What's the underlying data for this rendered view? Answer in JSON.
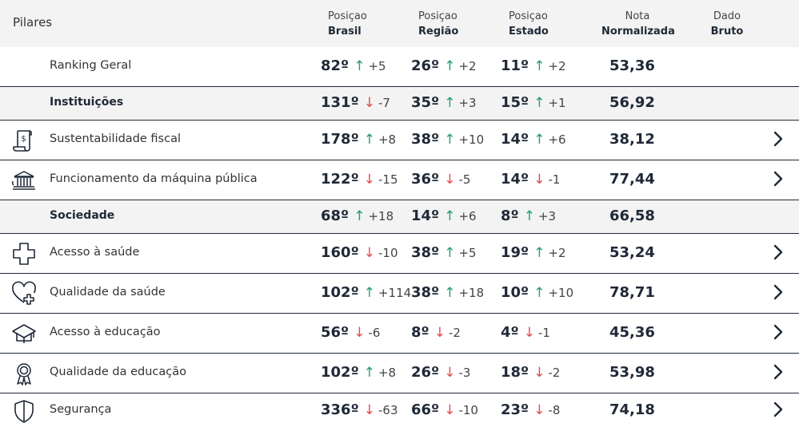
{
  "header": {
    "pilares": "Pilares",
    "col_brasil_top": "Posiçao",
    "col_brasil_sub": "Brasil",
    "col_regiao_top": "Posiçao",
    "col_regiao_sub": "Região",
    "col_estado_top": "Posiçao",
    "col_estado_sub": "Estado",
    "col_nota_top": "Nota",
    "col_nota_sub": "Normalizada",
    "col_dado_top": "Dado",
    "col_dado_sub": "Bruto"
  },
  "colors": {
    "up": "#22a06b",
    "down": "#e5484d",
    "group_bg": "#f3f3f3"
  },
  "rows": [
    {
      "label": "Ranking Geral",
      "icon": "none",
      "group": false,
      "brasil": {
        "rank": "82º",
        "dir": "up",
        "delta": "+5"
      },
      "regiao": {
        "rank": "26º",
        "dir": "up",
        "delta": "+2"
      },
      "estado": {
        "rank": "11º",
        "dir": "up",
        "delta": "+2"
      },
      "nota": "53,36",
      "chevron": false
    },
    {
      "label": "Instituições",
      "icon": "none",
      "group": true,
      "brasil": {
        "rank": "131º",
        "dir": "down",
        "delta": "-7"
      },
      "regiao": {
        "rank": "35º",
        "dir": "up",
        "delta": "+3"
      },
      "estado": {
        "rank": "15º",
        "dir": "up",
        "delta": "+1"
      },
      "nota": "56,92",
      "chevron": false
    },
    {
      "label": "Sustentabilidade fiscal",
      "icon": "fiscal-document-icon",
      "group": false,
      "brasil": {
        "rank": "178º",
        "dir": "up",
        "delta": "+8"
      },
      "regiao": {
        "rank": "38º",
        "dir": "up",
        "delta": "+10"
      },
      "estado": {
        "rank": "14º",
        "dir": "up",
        "delta": "+6"
      },
      "nota": "38,12",
      "chevron": true
    },
    {
      "label": "Funcionamento da máquina pública",
      "icon": "government-building-icon",
      "group": false,
      "brasil": {
        "rank": "122º",
        "dir": "down",
        "delta": "-15"
      },
      "regiao": {
        "rank": "36º",
        "dir": "down",
        "delta": "-5"
      },
      "estado": {
        "rank": "14º",
        "dir": "down",
        "delta": "-1"
      },
      "nota": "77,44",
      "chevron": true
    },
    {
      "label": "Sociedade",
      "icon": "none",
      "group": true,
      "brasil": {
        "rank": "68º",
        "dir": "up",
        "delta": "+18"
      },
      "regiao": {
        "rank": "14º",
        "dir": "up",
        "delta": "+6"
      },
      "estado": {
        "rank": "8º",
        "dir": "up",
        "delta": "+3"
      },
      "nota": "66,58",
      "chevron": false
    },
    {
      "label": "Acesso à saúde",
      "icon": "medical-cross-icon",
      "group": false,
      "brasil": {
        "rank": "160º",
        "dir": "down",
        "delta": "-10"
      },
      "regiao": {
        "rank": "38º",
        "dir": "up",
        "delta": "+5"
      },
      "estado": {
        "rank": "19º",
        "dir": "up",
        "delta": "+2"
      },
      "nota": "53,24",
      "chevron": true
    },
    {
      "label": "Qualidade da saúde",
      "icon": "heart-plus-icon",
      "group": false,
      "brasil": {
        "rank": "102º",
        "dir": "up",
        "delta": "+114"
      },
      "regiao": {
        "rank": "38º",
        "dir": "up",
        "delta": "+18"
      },
      "estado": {
        "rank": "10º",
        "dir": "up",
        "delta": "+10"
      },
      "nota": "78,71",
      "chevron": true
    },
    {
      "label": "Acesso à educação",
      "icon": "graduation-cap-icon",
      "group": false,
      "brasil": {
        "rank": "56º",
        "dir": "down",
        "delta": "-6"
      },
      "regiao": {
        "rank": "8º",
        "dir": "down",
        "delta": "-2"
      },
      "estado": {
        "rank": "4º",
        "dir": "down",
        "delta": "-1"
      },
      "nota": "45,36",
      "chevron": true
    },
    {
      "label": "Qualidade da educação",
      "icon": "award-ribbon-icon",
      "group": false,
      "brasil": {
        "rank": "102º",
        "dir": "up",
        "delta": "+8"
      },
      "regiao": {
        "rank": "26º",
        "dir": "down",
        "delta": "-3"
      },
      "estado": {
        "rank": "18º",
        "dir": "down",
        "delta": "-2"
      },
      "nota": "53,98",
      "chevron": true
    },
    {
      "label": "Segurança",
      "icon": "shield-icon",
      "group": false,
      "brasil": {
        "rank": "336º",
        "dir": "down",
        "delta": "-63"
      },
      "regiao": {
        "rank": "66º",
        "dir": "down",
        "delta": "-10"
      },
      "estado": {
        "rank": "23º",
        "dir": "down",
        "delta": "-8"
      },
      "nota": "74,18",
      "chevron": true
    }
  ]
}
